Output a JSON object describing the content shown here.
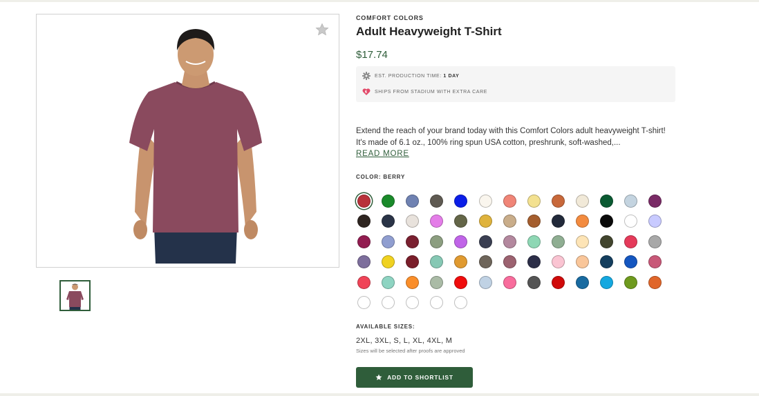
{
  "product": {
    "brand": "COMFORT COLORS",
    "title": "Adult Heavyweight T-Shirt",
    "price": "$17.74",
    "image_alt": "Model wearing berry t-shirt"
  },
  "production": {
    "label": "EST. PRODUCTION TIME:",
    "value": "1 DAY",
    "icon": "gear-icon"
  },
  "shipping": {
    "label": "SHIPS FROM STADIUM WITH EXTRA CARE",
    "icon": "heart-badge-icon"
  },
  "description": {
    "text": "Extend the reach of your brand today with this Comfort Colors adult heavyweight T-shirt! It's made of 6.1 oz., 100% ring spun USA cotton, preshrunk, soft-washed,...",
    "read_more": "READ MORE"
  },
  "color": {
    "label": "COLOR: BERRY",
    "selected_index": 0,
    "swatches": [
      "#b8323a",
      "#1a8a2a",
      "#6f82b2",
      "#5f5a52",
      "#0b1ee8",
      "#faf6ee",
      "#f08577",
      "#f3e190",
      "#c8683a",
      "#f1e9d8",
      "#0a5a32",
      "#c4d4e0",
      "#7a2b66",
      "#2e2520",
      "#2a3447",
      "#e8e2dc",
      "#e47de8",
      "#646648",
      "#dfb33c",
      "#c9ad8a",
      "#a55e2e",
      "#222a3a",
      "#f38b3f",
      "#0a0a0a",
      "#ffffff",
      "#c8caff",
      "#921c50",
      "#909ed0",
      "#7a2030",
      "#8c9e80",
      "#c064e8",
      "#3a3f52",
      "#b3889e",
      "#8ed7b4",
      "#8fae92",
      "#fde4b6",
      "#42452e",
      "#e53a5a",
      "#a8a8a8",
      "#7d6e9c",
      "#f0d220",
      "#7a1e2a",
      "#86c8b4",
      "#e09a30",
      "#6e655a",
      "#9c6270",
      "#2c2e48",
      "#fac4d2",
      "#f9c69a",
      "#143e5e",
      "#1456c0",
      "#c85878",
      "#f04458",
      "#8ed4c2",
      "#fa8e2a",
      "#aabba6",
      "#f00c0c",
      "#c0d2e4",
      "#f86c9c",
      "#545454",
      "#d00a0a",
      "#186aa0",
      "#14a8e0",
      "#6e9a1e",
      "#e0662a",
      "#ffffff",
      "#ffffff",
      "#ffffff",
      "#ffffff",
      "#ffffff"
    ]
  },
  "sizes": {
    "label": "AVAILABLE SIZES:",
    "list": "2XL, 3XL, S, L, XL, 4XL, M",
    "note": "Sizes will be selected after proofs are approved"
  },
  "actions": {
    "shortlist_label": "ADD TO SHORTLIST",
    "shortlist_icon": "star-icon",
    "favorite_icon": "star-icon"
  },
  "colors": {
    "accent": "#2f5d3a",
    "shirt": "#8a4a5e"
  }
}
